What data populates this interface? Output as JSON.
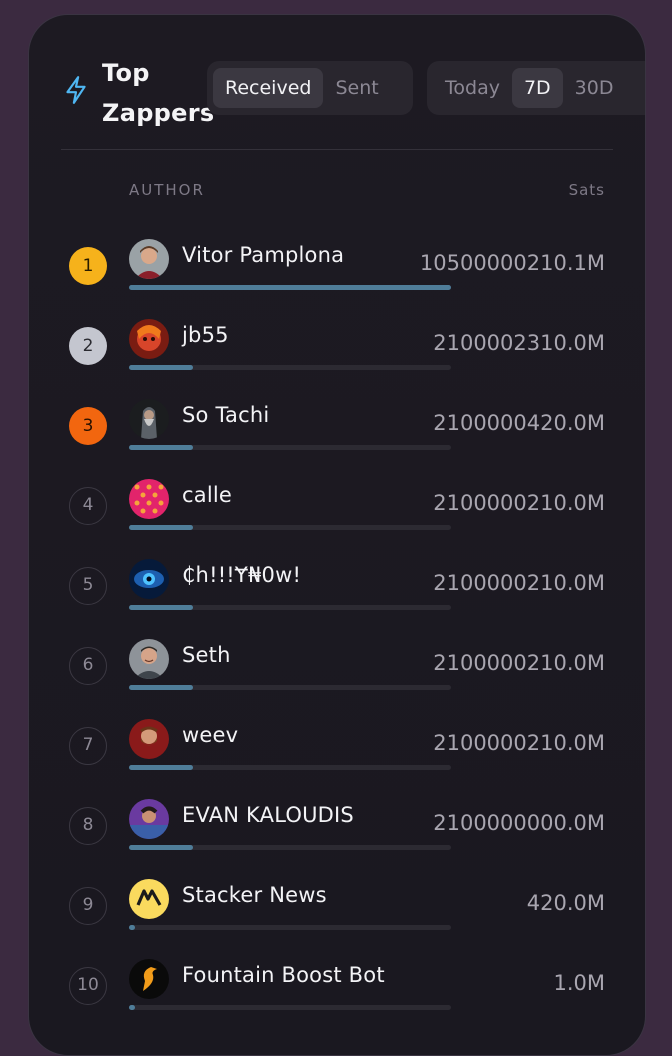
{
  "header": {
    "title_line1": "Top",
    "title_line2": "Zappers",
    "direction_tabs": [
      {
        "label": "Received",
        "active": true
      },
      {
        "label": "Sent",
        "active": false
      }
    ],
    "period_tabs": [
      {
        "label": "Today",
        "active": false
      },
      {
        "label": "7D",
        "active": true
      },
      {
        "label": "30D",
        "active": false
      }
    ]
  },
  "table": {
    "col_author": "AUTHOR",
    "col_sats": "Sats",
    "rows": [
      {
        "rank": "1",
        "name": "Vitor Pamplona",
        "sats": "10500000210.1M",
        "share": 1.0,
        "medal": "gold",
        "avatar": "photo-man-brown-hair"
      },
      {
        "rank": "2",
        "name": "jb55",
        "sats": "2100002310.0M",
        "share": 0.2,
        "medal": "silver",
        "avatar": "photo-red-face"
      },
      {
        "rank": "3",
        "name": "So Tachi",
        "sats": "2100000420.0M",
        "share": 0.2,
        "medal": "bronze",
        "avatar": "photo-wizard"
      },
      {
        "rank": "4",
        "name": "calle",
        "sats": "2100000210.0M",
        "share": 0.2,
        "medal": "none",
        "avatar": "pattern-pink"
      },
      {
        "rank": "5",
        "name": "₵h!!!Ɏ₦0w!",
        "sats": "2100000210.0M",
        "share": 0.2,
        "medal": "none",
        "avatar": "eye-blue"
      },
      {
        "rank": "6",
        "name": "Seth",
        "sats": "2100000210.0M",
        "share": 0.2,
        "medal": "none",
        "avatar": "photo-man-smile"
      },
      {
        "rank": "7",
        "name": "weev",
        "sats": "2100000210.0M",
        "share": 0.2,
        "medal": "none",
        "avatar": "photo-bearded-man"
      },
      {
        "rank": "8",
        "name": "EVAN KALOUDIS",
        "sats": "2100000000.0M",
        "share": 0.2,
        "medal": "none",
        "avatar": "photo-man-purple"
      },
      {
        "rank": "9",
        "name": "Stacker News",
        "sats": "420.0M",
        "share": 0.02,
        "medal": "none",
        "avatar": "sn-logo"
      },
      {
        "rank": "10",
        "name": "Fountain Boost Bot",
        "sats": "1.0M",
        "share": 0.02,
        "medal": "none",
        "avatar": "fountain-logo"
      }
    ]
  },
  "colors": {
    "bar_fill": "#4f7d99",
    "gold": "#f6b21b",
    "silver": "#c4c6cf",
    "bronze": "#f2660f",
    "accent_icon": "#4fb6f2"
  },
  "icons": {
    "header": "lightning-bolt-icon"
  }
}
